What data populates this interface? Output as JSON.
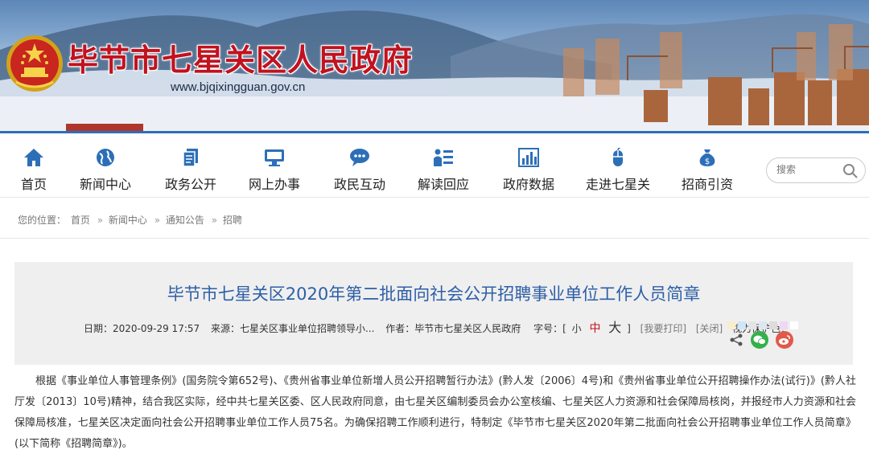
{
  "site": {
    "title": "毕节市七星关区人民政府",
    "url": "www.bjqixingguan.gov.cn"
  },
  "nav": {
    "items": [
      {
        "label": "首页",
        "icon": "home-icon"
      },
      {
        "label": "新闻中心",
        "icon": "globe-icon"
      },
      {
        "label": "政务公开",
        "icon": "document-icon"
      },
      {
        "label": "网上办事",
        "icon": "monitor-icon"
      },
      {
        "label": "政民互动",
        "icon": "chat-icon"
      },
      {
        "label": "解读回应",
        "icon": "list-icon"
      },
      {
        "label": "政府数据",
        "icon": "bar-chart-icon"
      },
      {
        "label": "走进七星关",
        "icon": "mouse-icon"
      },
      {
        "label": "招商引资",
        "icon": "money-bag-icon"
      }
    ],
    "accent": "#2d6fb7"
  },
  "search": {
    "placeholder": "搜索",
    "icon": "search-icon"
  },
  "breadcrumb": {
    "prefix": "您的位置：",
    "items": [
      "首页",
      "新闻中心",
      "通知公告",
      "招聘"
    ],
    "separator": "»"
  },
  "article": {
    "title": "毕节市七星关区2020年第二批面向社会公开招聘事业单位工作人员简章",
    "meta": {
      "date": "日期：2020-09-29 17:57",
      "source": "来源：七星关区事业单位招聘领导小...",
      "author": "作者：毕节市七星关区人民政府",
      "fontsize_label": "字号：[",
      "fontsize_small": "小",
      "fontsize_mid": "中",
      "fontsize_big": "大",
      "fontsize_end": "]",
      "print": "[我要打印]",
      "close": "[关闭]",
      "eye_label": "视力保护色："
    },
    "swatch_colors": [
      "#f9edcb",
      "#cfe6f7",
      "#e4e4e4",
      "#dce7f3",
      "#dcdcdc",
      "#eed8f2",
      "#ffffff"
    ],
    "share_icons": [
      "share-icon",
      "wechat-icon",
      "weibo-icon"
    ],
    "body": "根据《事业单位人事管理条例》(国务院令第652号)、《贵州省事业单位新增人员公开招聘暂行办法》(黔人发〔2006〕4号)和《贵州省事业单位公开招聘操作办法(试行)》(黔人社厅发〔2013〕10号)精神，结合我区实际，经中共七星关区委、区人民政府同意，由七星关区编制委员会办公室核编、七星关区人力资源和社会保障局核岗，并报经市人力资源和社会保障局核准，七星关区决定面向社会公开招聘事业单位工作人员75名。为确保招聘工作顺利进行，特制定《毕节市七星关区2020年第二批面向社会公开招聘事业单位工作人员简章》(以下简称《招聘简章》)。"
  },
  "colors": {
    "title_red": "#c1121f",
    "article_title_blue": "#2d5fa6"
  }
}
